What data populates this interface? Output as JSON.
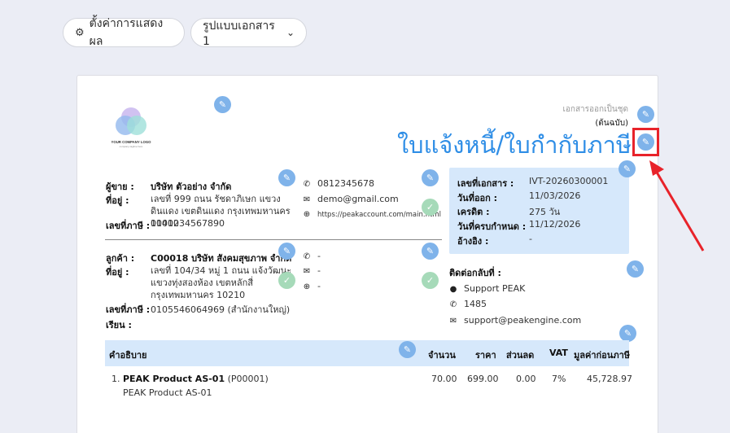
{
  "toolbar": {
    "display_settings_label": "ตั้งค่าการแสดงผล",
    "doc_format_label": "รูปแบบเอกสาร 1"
  },
  "header": {
    "logo_text": "YOUR COMPANY LOGO",
    "logo_subtext": "company tagline here",
    "copy_type": "เอกสารออกเป็นชุด",
    "original_label": "(ต้นฉบับ)",
    "title": "ใบแจ้งหนี้/ใบกำกับภาษี"
  },
  "seller": {
    "label": "ผู้ขาย :",
    "name": "บริษัท ตัวอย่าง จำกัด",
    "address_label": "ที่อยู่ :",
    "address": "เลขที่ 999 ถนน รัชดาภิเษก แขวงดินแดง เขตดินแดง กรุงเทพมหานคร 10400",
    "tax_label": "เลขที่ภาษี :",
    "tax_id": "0101234567890",
    "phone": "0812345678",
    "email": "demo@gmail.com",
    "website": "https://peakaccount.com/main.html"
  },
  "customer": {
    "label": "ลูกค้า :",
    "name": "C00018 บริษัท สังคมสุขภาพ จำกัด",
    "address_label": "ที่อยู่ :",
    "address": "เลขที่ 104/34 หมู่ 1 ถนน แจ้งวัฒนะ แขวงทุ่งสองห้อง เขตหลักสี่ กรุงเทพมหานคร 10210",
    "tax_label": "เลขที่ภาษี :",
    "tax_id": "0105546064969 (สำนักงานใหญ่)",
    "attn_label": "เรียน :",
    "phone": "-",
    "email": "-",
    "website": "-"
  },
  "doc_info": {
    "number_label": "เลขที่เอกสาร :",
    "number": "IVT-20260300001",
    "issue_label": "วันที่ออก :",
    "issue_date": "11/03/2026",
    "credit_label": "เครดิต :",
    "credit": "275 วัน",
    "due_label": "วันที่ครบกำหนด :",
    "due_date": "11/12/2026",
    "ref_label": "อ้างอิง :",
    "ref": "-"
  },
  "contact": {
    "label": "ติดต่อกลับที่ :",
    "name": "Support PEAK",
    "phone": "1485",
    "email": "support@peakengine.com"
  },
  "table": {
    "headers": {
      "description": "คำอธิบาย",
      "qty": "จำนวน",
      "price": "ราคา",
      "discount": "ส่วนลด",
      "vat": "VAT",
      "amount": "มูลค่าก่อนภาษี"
    },
    "rows": [
      {
        "index": "1.",
        "name": "PEAK Product AS-01",
        "code": "(P00001)",
        "subtitle": "PEAK Product AS-01",
        "qty": "70.00",
        "price": "699.00",
        "discount": "0.00",
        "vat": "7%",
        "amount": "45,728.97"
      }
    ]
  },
  "colors": {
    "title_blue": "#2f8ee6",
    "pen_blue": "#7fb3ea",
    "info_bg": "#d6e8fb",
    "highlight_red": "#e8232a"
  }
}
